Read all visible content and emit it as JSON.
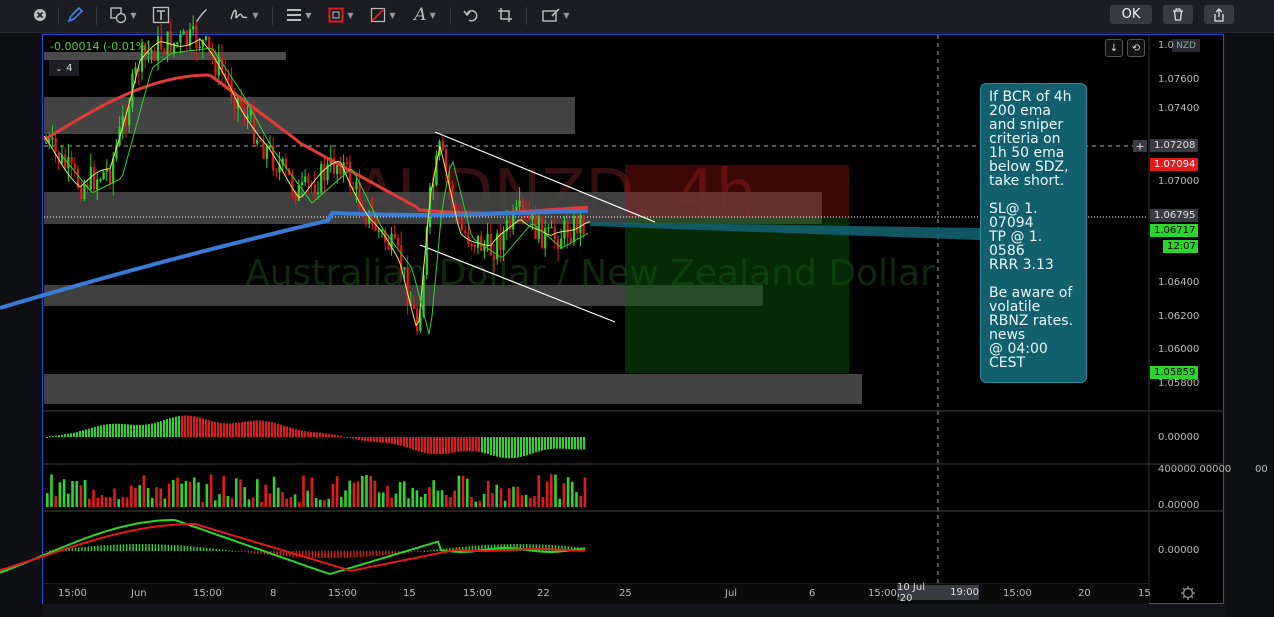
{
  "toolbar": {
    "ok_label": "OK",
    "icons": [
      "close-icon",
      "pen-icon",
      "shapes-icon",
      "text-icon",
      "brush-icon",
      "signature-icon",
      "line-style-icon",
      "border-color-icon",
      "fill-color-icon",
      "font-icon",
      "undo-icon",
      "crop-icon",
      "template-icon",
      "trash-icon",
      "share-icon"
    ]
  },
  "legend": {
    "change": "-0.00014 (-0.01%)",
    "collapse_count": "4"
  },
  "currency_badge": "NZD",
  "price_axis": {
    "labels": [
      "1.0",
      "1.07600",
      "1.07400",
      "1.07000",
      "1.06400",
      "1.06200",
      "1.06000",
      "1.05800"
    ],
    "tags": [
      {
        "text": "1.07208",
        "bg": "#3a3b42",
        "fg": "#e0e0e0"
      },
      {
        "text": "1.07094",
        "bg": "#e31a1a",
        "fg": "#ffffff"
      },
      {
        "text": "1.06795",
        "bg": "#3a3b42",
        "fg": "#e0e0e0"
      },
      {
        "text": "1.06717",
        "bg": "#2bd62b",
        "fg": "#000000"
      },
      {
        "text": "12:07",
        "bg": "#2bd62b",
        "fg": "#000000"
      },
      {
        "text": "1.05859",
        "bg": "#2bd62b",
        "fg": "#000000"
      }
    ]
  },
  "indicators": {
    "ao_label": "0.00000",
    "volume_label": "400000.00000",
    "volume_zero": "0.00000",
    "macd_label": "0.00000"
  },
  "right_strip_label": "00",
  "watermark": {
    "symbol": "AUDNZD, 4h",
    "name": "Australian Dollar / New Zealand Dollar"
  },
  "note_text": "If BCR of 4h\n200 ema\nand sniper\ncriteria on\n1h 50 ema\nbelow SDZ,\ntake short.\n\nSL@ 1.\n07094\nTP @ 1.\n0586\nRRR 3.13\n\nBe aware of\nvolatile\nRBNZ rates.\nnews\n@ 04:00\nCEST",
  "time_axis": {
    "labels": [
      "15:00",
      "Jun",
      "15:00",
      "8",
      "15:00",
      "15",
      "15:00",
      "22",
      "25",
      "Jul",
      "6",
      "15:00",
      "19:00",
      "15:00",
      "20",
      "15"
    ],
    "cursor_label": "10 Jul '20"
  },
  "colors": {
    "bull": "#2bd62b",
    "bear": "#e31a1a",
    "ema200": "#3a7bd5",
    "ema50": "#e03a3a",
    "frame": "#2b4ad8",
    "note_bg": "#12606e"
  }
}
